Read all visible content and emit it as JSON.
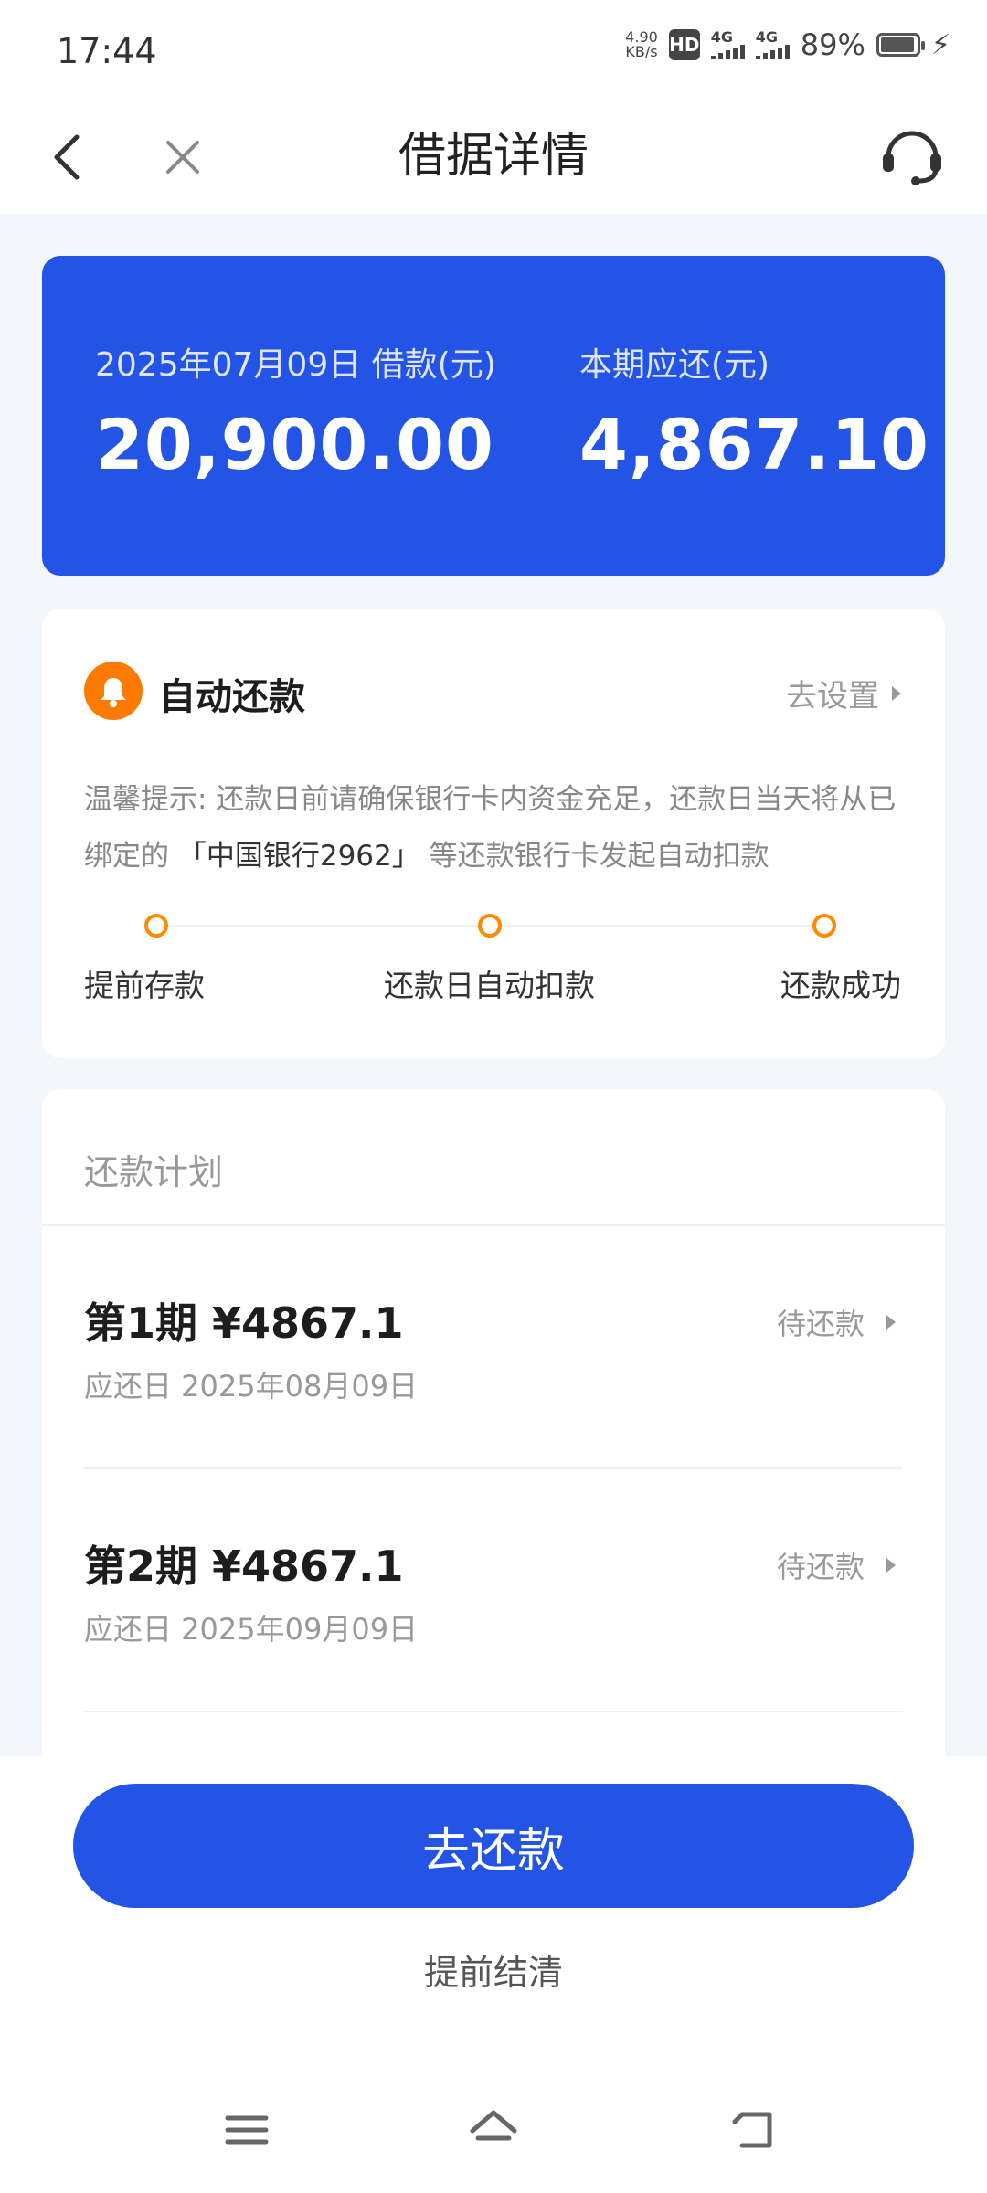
{
  "status_bar": {
    "time": "17:44",
    "net_speed_value": "4.90",
    "net_speed_unit": "KB/s",
    "hd_label": "HD",
    "signal1_label": "4G",
    "signal2_label": "4G",
    "battery_percent": "89%"
  },
  "nav": {
    "title": "借据详情"
  },
  "summary": {
    "loan_label": "2025年07月09日 借款(元)",
    "loan_amount": "20,900.00",
    "due_label": "本期应还(元)",
    "due_amount": "4,867.10"
  },
  "auto_repay": {
    "title": "自动还款",
    "settings_link": "去设置",
    "notice_prefix": "温馨提示: 还款日前请确保银行卡内资金充足，还款日当天将从已绑定的",
    "notice_bank": "「中国银行2962」",
    "notice_suffix": "等还款银行卡发起自动扣款",
    "steps": [
      "提前存款",
      "还款日自动扣款",
      "还款成功"
    ]
  },
  "plan": {
    "header": "还款计划",
    "installments": [
      {
        "title": "第1期 ¥4867.1",
        "date": "应还日 2025年08月09日",
        "status": "待还款"
      },
      {
        "title": "第2期 ¥4867.1",
        "date": "应还日 2025年09月09日",
        "status": "待还款"
      }
    ]
  },
  "actions": {
    "pay_label": "去还款",
    "early_settle_label": "提前结清"
  },
  "colors": {
    "brand_blue": "#2354E6",
    "accent_orange": "#FF7A00"
  },
  "icons": [
    "back-arrow-icon",
    "close-icon",
    "customer-service-icon",
    "bell-icon",
    "menu-icon",
    "home-icon",
    "return-icon"
  ]
}
